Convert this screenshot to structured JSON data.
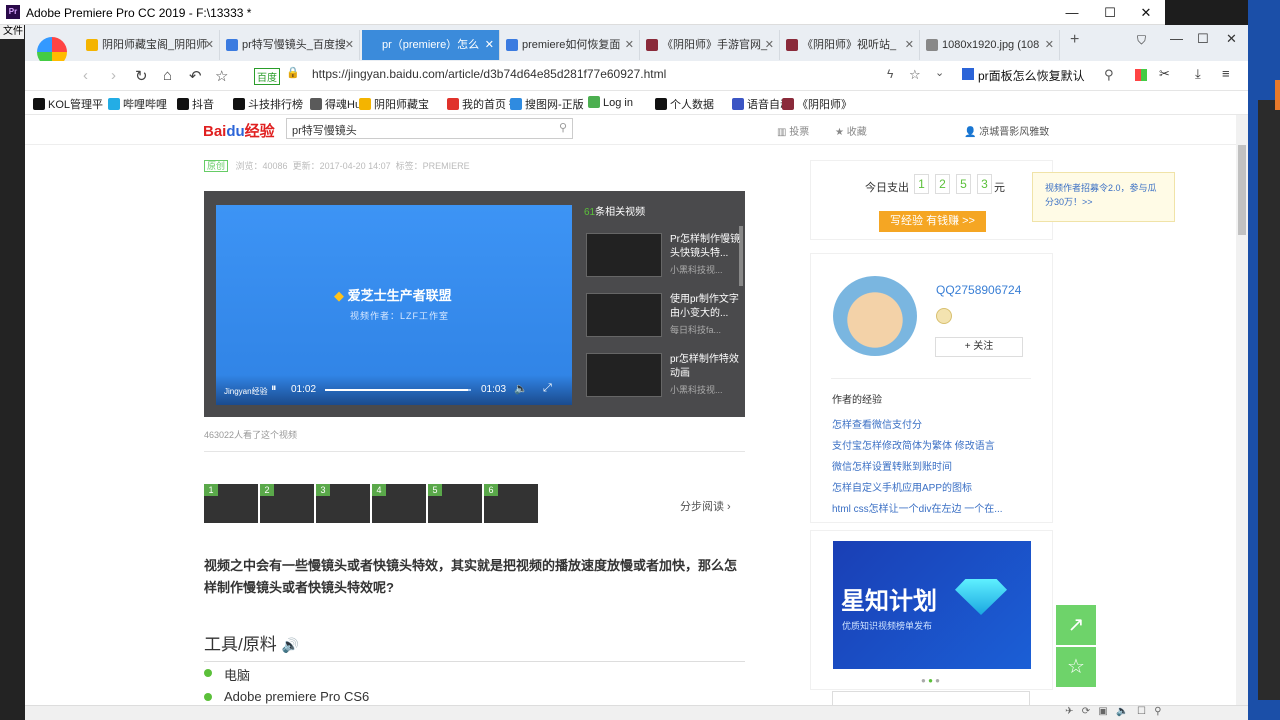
{
  "app": {
    "title": "Adobe Premiere Pro CC 2019 - F:\\13333 *",
    "menu_label": "文件"
  },
  "tabs": [
    {
      "label": "阴阳师藏宝阁_阴阳师",
      "icon_color": "#f4b400"
    },
    {
      "label": "pr特写慢镜头_百度搜",
      "icon_color": "#3b7be0"
    },
    {
      "label": "pr（premiere）怎么",
      "icon_color": "#3b8bdb"
    },
    {
      "label": "premiere如何恢复面",
      "icon_color": "#3b7be0"
    },
    {
      "label": "《阴阳师》手游官网_",
      "icon_color": "#8a2a3a"
    },
    {
      "label": "《阴阳师》视听站_",
      "icon_color": "#8a2a3a"
    },
    {
      "label": "1080x1920.jpg (108",
      "icon_color": "#888888"
    }
  ],
  "address": {
    "safe_label": "百度",
    "url": "https://jingyan.baidu.com/article/d3b74d64e85d281f77e60927.html",
    "right_search": "pr面板怎么恢复默认"
  },
  "bookmarks": [
    {
      "label": "KOL管理平",
      "color": "#111111"
    },
    {
      "label": "哔哩哔哩",
      "color": "#23ade5"
    },
    {
      "label": "抖音",
      "color": "#111111"
    },
    {
      "label": "斗技排行榜",
      "color": "#111111"
    },
    {
      "label": "得魂Hub",
      "color": "#5a5a5a"
    },
    {
      "label": "阴阳师藏宝",
      "color": "#f4b400"
    },
    {
      "label": "我的首页 微",
      "color": "#e0322b"
    },
    {
      "label": "搜图网-正版",
      "color": "#2f8be0"
    },
    {
      "label": "Log in",
      "color": "#4caf50"
    },
    {
      "label": "个人数据",
      "color": "#111111"
    },
    {
      "label": "语音自动",
      "color": "#3b55c4"
    },
    {
      "label": "《阴阳师》",
      "color": "#8a2a3a"
    }
  ],
  "site": {
    "logo_left": "Bai",
    "logo_mid": "du",
    "logo_right": "经验",
    "search_value": "pr特写慢镜头",
    "nav_items": [
      "投票",
      "收藏"
    ],
    "user": "凉城晋影风雅致"
  },
  "header_meta": {
    "tag": "原创",
    "items": [
      "浏览：40086",
      "更新：2017-04-20 14:07",
      "标签：PREMIERE"
    ]
  },
  "video": {
    "related_count": "61",
    "related_label": "条相关视频",
    "brand": "爱芝士生产者联盟",
    "author": "视频作者：LZF工作室",
    "corner": "Jingyan经验",
    "time_cur": "01:02",
    "time_total": "01:03",
    "progress": 0.98,
    "views": "463022人看了这个视频",
    "related": [
      {
        "title": "Pr怎样制作慢镜头快镜头特...",
        "author": "小黑科技视..."
      },
      {
        "title": "使用pr制作文字由小变大的...",
        "author": "每日科技fa..."
      },
      {
        "title": "pr怎样制作特效动画",
        "author": "小黑科技视..."
      }
    ]
  },
  "steps": {
    "numbers": [
      "1",
      "2",
      "3",
      "4",
      "5",
      "6"
    ],
    "read_label": "分步阅读"
  },
  "article": {
    "intro": "视频之中会有一些慢镜头或者快镜头特效，其实就是把视频的播放速度放慢或者加快，那么怎样制作慢镜头或者快镜头特效呢?",
    "tools_heading": "工具/原料",
    "tools": [
      "电脑",
      "Adobe premiere Pro CS6"
    ]
  },
  "sidebar": {
    "today_label": "今日支出",
    "today_digits": [
      "1",
      "2",
      "5",
      "3"
    ],
    "today_unit": "元",
    "cta": "写经验 有钱赚 >>",
    "tooltip": "视频作者招募令2.0，参与瓜分30万！>>",
    "author_name": "QQ2758906724",
    "follow": "+ 关注",
    "author_exp_title": "作者的经验",
    "author_links": [
      "怎样查看微信支付分",
      "支付宝怎样修改简体为繁体 修改语言",
      "微信怎样设置转账到账时间",
      "怎样自定义手机应用APP的图标",
      "html css怎样让一个div在左边 一个在..."
    ],
    "banner_title": "星知计划",
    "banner_sub": "优质知识视频榜单发布"
  }
}
